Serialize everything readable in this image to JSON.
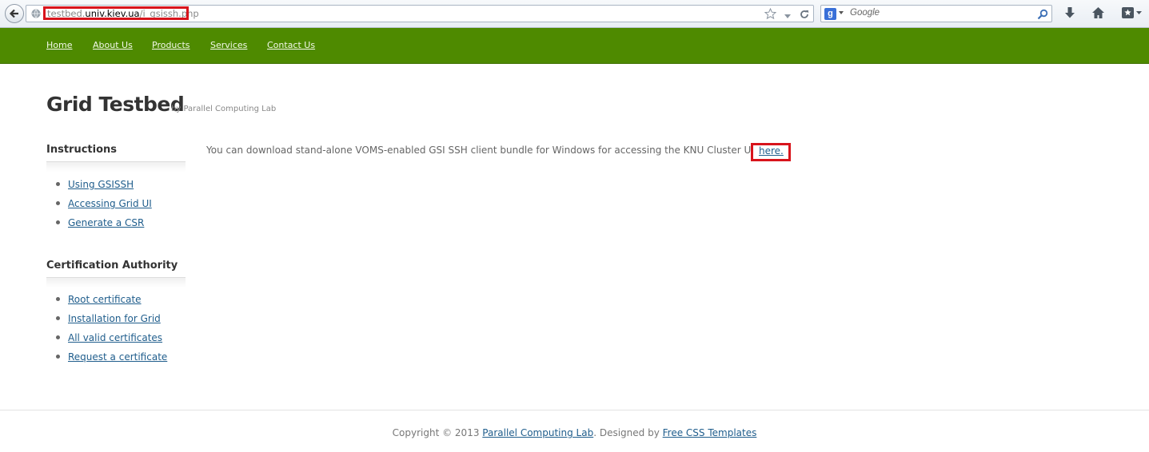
{
  "browser": {
    "url_prefix": "testbed.",
    "url_domain": "univ.kiev.ua",
    "url_path": "/i_gsissh.php",
    "search_placeholder": "Google",
    "highlight_color": "#d8141c"
  },
  "nav": {
    "items": [
      {
        "label": "Home"
      },
      {
        "label": "About Us"
      },
      {
        "label": "Products"
      },
      {
        "label": "Services"
      },
      {
        "label": "Contact Us"
      }
    ],
    "background": "#4e8a00"
  },
  "header": {
    "title": "Grid Testbed",
    "subtitle": "by Parallel Computing Lab"
  },
  "sidebar": {
    "sections": [
      {
        "heading": "Instructions",
        "links": [
          "Using GSISSH",
          "Accessing Grid UI",
          "Generate a CSR"
        ]
      },
      {
        "heading": "Certification Authority",
        "links": [
          "Root certificate",
          "Installation for Grid",
          "All valid certificates",
          "Request a certificate"
        ]
      }
    ]
  },
  "main": {
    "text": "You can download stand-alone VOMS-enabled GSI SSH client bundle for Windows for accessing the KNU Cluster UI from",
    "link_label": "here."
  },
  "footer": {
    "prefix": "Copyright © 2013",
    "lab_link": "Parallel Computing Lab",
    "middle": ". Designed by",
    "templates_link": "Free CSS Templates"
  }
}
